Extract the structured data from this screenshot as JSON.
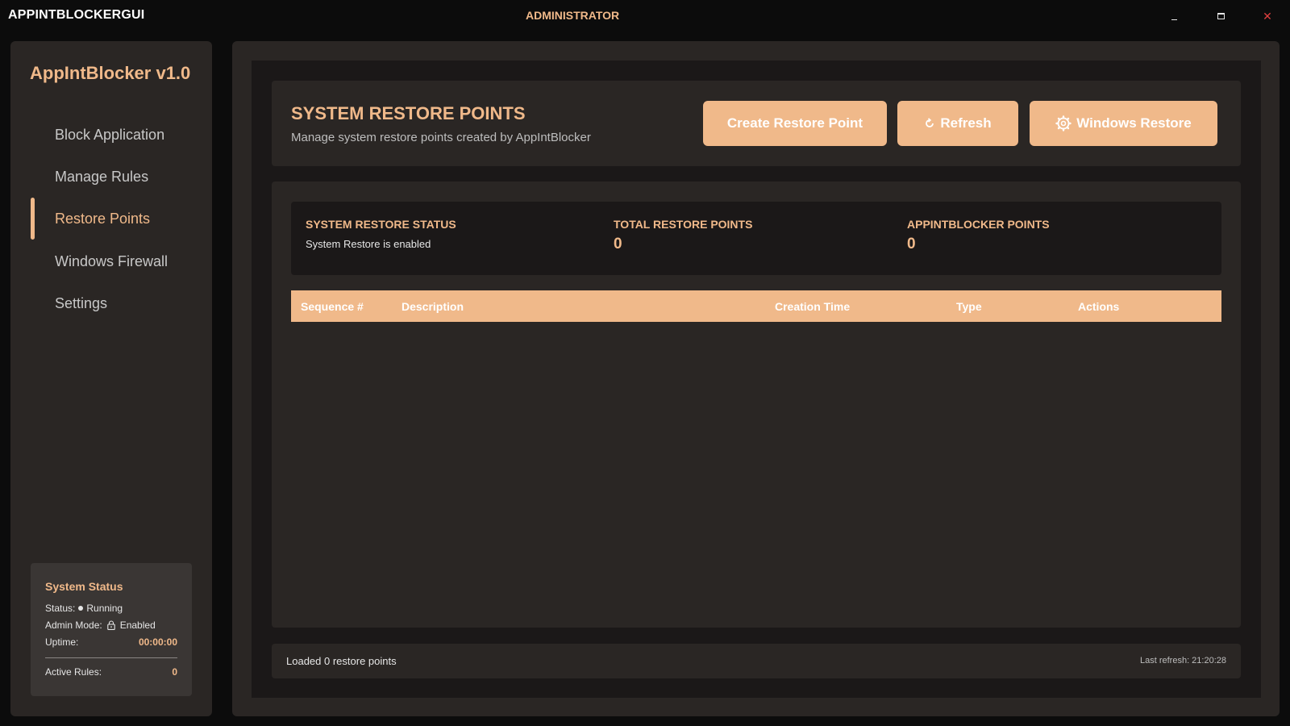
{
  "window": {
    "app_name": "APPINTBLOCKERGUI",
    "admin_label": "ADMINISTRATOR",
    "minimize_icon": "minimize-icon",
    "maximize_icon": "maximize-icon",
    "close_icon": "close-icon",
    "close_glyph": "✕"
  },
  "sidebar": {
    "brand": "AppIntBlocker v1.0",
    "items": [
      {
        "label": "Block Application",
        "active": false
      },
      {
        "label": "Manage Rules",
        "active": false
      },
      {
        "label": "Restore Points",
        "active": true
      },
      {
        "label": "Windows Firewall",
        "active": false
      },
      {
        "label": "Settings",
        "active": false
      }
    ],
    "status": {
      "title": "System Status",
      "status_label": "Status:",
      "status_value": "Running",
      "admin_label": "Admin Mode:",
      "admin_value": "Enabled",
      "uptime_label": "Uptime:",
      "uptime_value": "00:00:00",
      "rules_label": "Active Rules:",
      "rules_value": "0"
    }
  },
  "header": {
    "title": "SYSTEM RESTORE POINTS",
    "subtitle": "Manage system restore points created by AppIntBlocker",
    "buttons": {
      "create": "Create Restore Point",
      "refresh": "Refresh",
      "windows_restore": "Windows Restore"
    }
  },
  "stats": {
    "status_label": "SYSTEM RESTORE STATUS",
    "status_text": "System Restore is enabled",
    "total_label": "TOTAL RESTORE POINTS",
    "total_value": "0",
    "appint_label": "APPINTBLOCKER POINTS",
    "appint_value": "0"
  },
  "table": {
    "columns": [
      "Sequence #",
      "Description",
      "Creation Time",
      "Type",
      "Actions"
    ],
    "rows": []
  },
  "footer": {
    "left": "Loaded 0 restore points",
    "right": "Last refresh: 21:20:28"
  },
  "colors": {
    "accent": "#f0b98a",
    "background": "#0c0c0c",
    "panel": "#2a2624",
    "inner": "#1b1818",
    "close": "#e04040"
  }
}
